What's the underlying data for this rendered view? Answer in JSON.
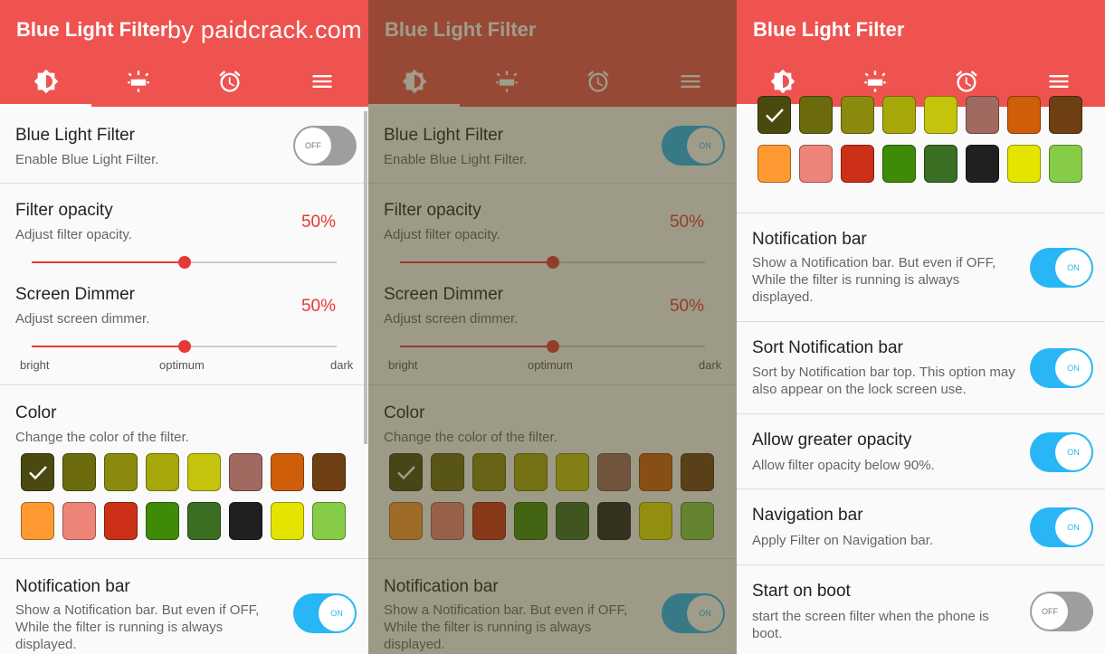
{
  "watermark": "by paidcrack.com",
  "panels": [
    {
      "app_title": "Blue Light Filter",
      "filter": {
        "title": "Blue Light Filter",
        "subtitle": "Enable Blue Light Filter.",
        "switch": "OFF"
      },
      "opacity": {
        "title": "Filter opacity",
        "subtitle": "Adjust filter opacity.",
        "value": "50%",
        "level": 0.5
      },
      "dimmer": {
        "title": "Screen Dimmer",
        "subtitle": "Adjust screen dimmer.",
        "value": "50%",
        "level": 0.5
      },
      "range": {
        "low": "bright",
        "mid": "optimum",
        "high": "dark"
      },
      "color": {
        "title": "Color",
        "subtitle": "Change the color of the filter."
      },
      "notification": {
        "title": "Notification bar",
        "subtitle": "Show a Notification bar. But even if OFF, While the filter is running is always displayed.",
        "switch": "ON"
      }
    },
    {
      "app_title": "Blue Light Filter",
      "filter": {
        "title": "Blue Light Filter",
        "subtitle": "Enable Blue Light Filter.",
        "switch": "ON"
      },
      "opacity": {
        "title": "Filter opacity",
        "subtitle": "Adjust filter opacity.",
        "value": "50%",
        "level": 0.5
      },
      "dimmer": {
        "title": "Screen Dimmer",
        "subtitle": "Adjust screen dimmer.",
        "value": "50%",
        "level": 0.5
      },
      "range": {
        "low": "bright",
        "mid": "optimum",
        "high": "dark"
      },
      "color": {
        "title": "Color",
        "subtitle": "Change the color of the filter."
      },
      "notification": {
        "title": "Notification bar",
        "subtitle": "Show a Notification bar. But even if OFF, While the filter is running is always displayed.",
        "switch": "ON"
      }
    },
    {
      "app_title": "Blue Light Filter",
      "settings": [
        {
          "title": "Notification bar",
          "subtitle": "Show a Notification bar. But even if OFF, While the filter is running is always displayed.",
          "switch": "ON"
        },
        {
          "title": "Sort Notification bar",
          "subtitle": "Sort by Notification bar top. This option may also appear on the lock screen use.",
          "switch": "ON"
        },
        {
          "title": "Allow greater opacity",
          "subtitle": "Allow filter opacity below 90%.",
          "switch": "ON"
        },
        {
          "title": "Navigation bar",
          "subtitle": "Apply Filter on Navigation bar.",
          "switch": "ON"
        },
        {
          "title": "Start on boot",
          "subtitle": "start the screen filter when the phone is boot.",
          "switch": "OFF"
        }
      ]
    }
  ],
  "tabs": [
    {
      "icon": "brightness-icon"
    },
    {
      "icon": "filter-lamp-icon"
    },
    {
      "icon": "alarm-clock-icon"
    },
    {
      "icon": "menu-icon"
    }
  ],
  "selected_tab": 0,
  "swatch_colors": [
    "#4a4a10",
    "#6b6b0e",
    "#8a8a0f",
    "#a6a80a",
    "#c4c40c",
    "#a06a60",
    "#cf5e0a",
    "#6e3f12",
    "#ff9a32",
    "#ee8478",
    "#cc3016",
    "#3f8a06",
    "#3a6e22",
    "#202020",
    "#e4e400",
    "#86cc46"
  ],
  "selected_swatch": 0,
  "colors": {
    "accent": "#ef5350",
    "slider": "#e53935",
    "switch_on": "#29b6f6",
    "switch_off": "#9e9e9e"
  }
}
